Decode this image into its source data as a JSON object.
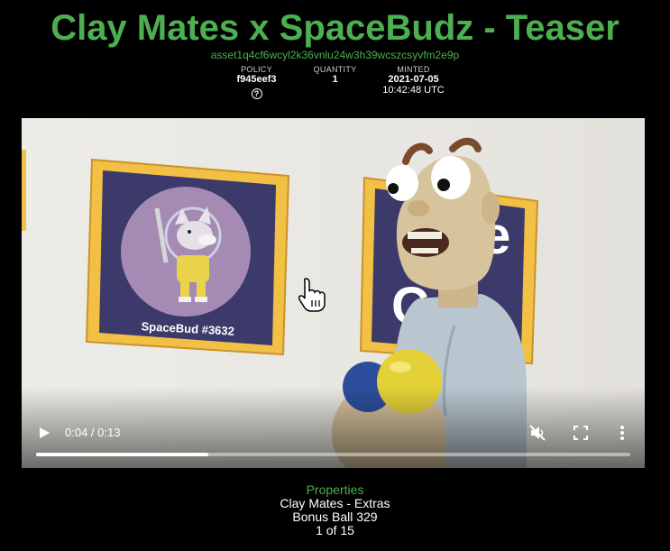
{
  "header": {
    "title": "Clay Mates x SpaceBudz - Teaser",
    "asset_id": "asset1q4cf6wcyl2k36vnlu24w3h39wcszcsyvfm2e9p"
  },
  "meta": {
    "policy_label": "POLICY",
    "policy_value": "f945eef3",
    "quantity_label": "QUANTITY",
    "quantity_value": "1",
    "minted_label": "MINTED",
    "minted_date": "2021-07-05",
    "minted_time": "10:42:48 UTC"
  },
  "video": {
    "poster_text": "SpaceBud #3632",
    "current_time": "0:04",
    "duration": "0:13",
    "time_display": "0:04 / 0:13",
    "progress": 0.29,
    "muted": true
  },
  "properties": {
    "heading": "Properties",
    "items": [
      "Clay Mates - Extras",
      "Bonus Ball 329",
      "1 of 15"
    ]
  },
  "colors": {
    "accent": "#4caf50",
    "background": "#000000"
  }
}
